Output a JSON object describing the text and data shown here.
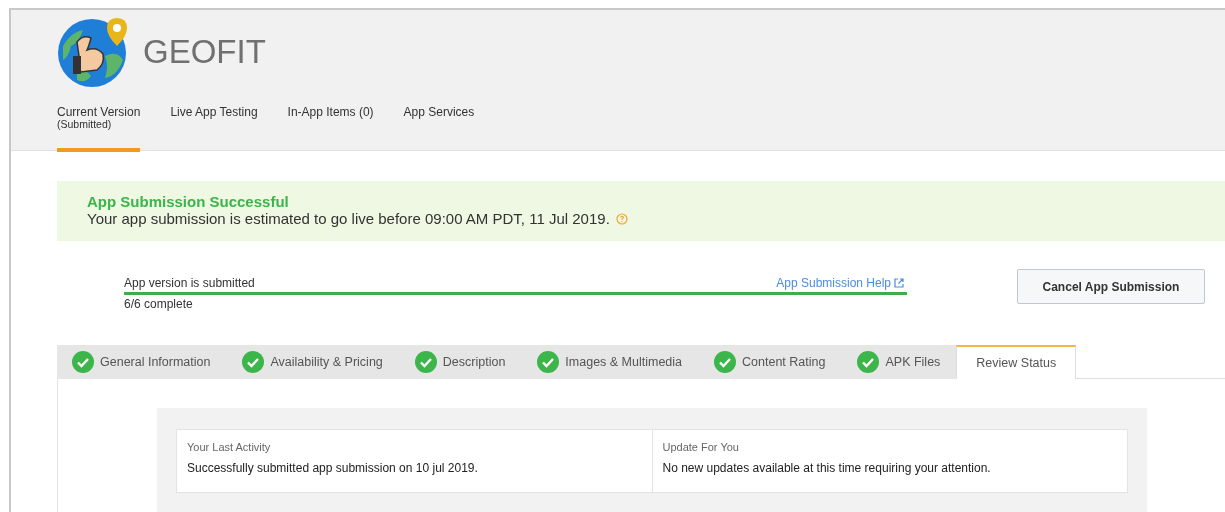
{
  "app": {
    "name": "GEOFIT"
  },
  "tabs": [
    {
      "label": "Current Version",
      "sublabel": "(Submitted)",
      "selected": true
    },
    {
      "label": "Live App Testing",
      "selected": false
    },
    {
      "label": "In-App Items (0)",
      "selected": false
    },
    {
      "label": "App Services",
      "selected": false
    }
  ],
  "banner": {
    "title": "App Submission Successful",
    "message": "Your app submission is estimated to go live before 09:00 AM PDT, 11 Jul 2019."
  },
  "progress": {
    "label": "App version is submitted",
    "help_link": "App Submission Help",
    "level": 1,
    "count": "6/6 complete"
  },
  "cancel_button": "Cancel App Submission",
  "steps": [
    {
      "label": "General Information",
      "completed": true,
      "selected": false
    },
    {
      "label": "Availability & Pricing",
      "completed": true,
      "selected": false
    },
    {
      "label": "Description",
      "completed": true,
      "selected": false
    },
    {
      "label": "Images & Multimedia",
      "completed": true,
      "selected": false
    },
    {
      "label": "Content Rating",
      "completed": true,
      "selected": false
    },
    {
      "label": "APK Files",
      "completed": true,
      "selected": false
    },
    {
      "label": "Review Status",
      "completed": false,
      "selected": true
    }
  ],
  "status_cards": [
    {
      "heading": "Your Last Activity",
      "text": "Successfully submitted app submission on 10 jul 2019."
    },
    {
      "heading": "Update For You",
      "text": "No new updates available at this time requiring your attention."
    }
  ]
}
